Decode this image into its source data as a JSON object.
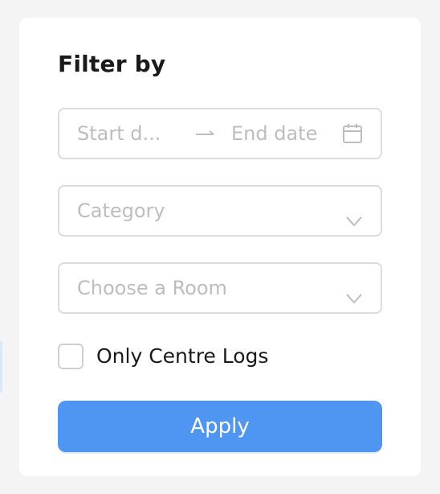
{
  "filter": {
    "title": "Filter by",
    "date_range": {
      "start_placeholder": "Start d...",
      "end_placeholder": "End date",
      "separator_icon": "arrow-right-icon",
      "icon": "calendar-icon"
    },
    "category": {
      "placeholder": "Category",
      "icon": "chevron-down-icon"
    },
    "room": {
      "placeholder": "Choose a Room",
      "icon": "chevron-down-icon"
    },
    "only_centre_logs": {
      "label": "Only Centre Logs",
      "checked": false
    },
    "apply_label": "Apply"
  },
  "colors": {
    "accent": "#4f96f2",
    "background": "#f4f4f4",
    "panel": "#ffffff",
    "border": "#dcdcdc",
    "placeholder": "#bdbdbd",
    "text": "#1a1a1a"
  }
}
